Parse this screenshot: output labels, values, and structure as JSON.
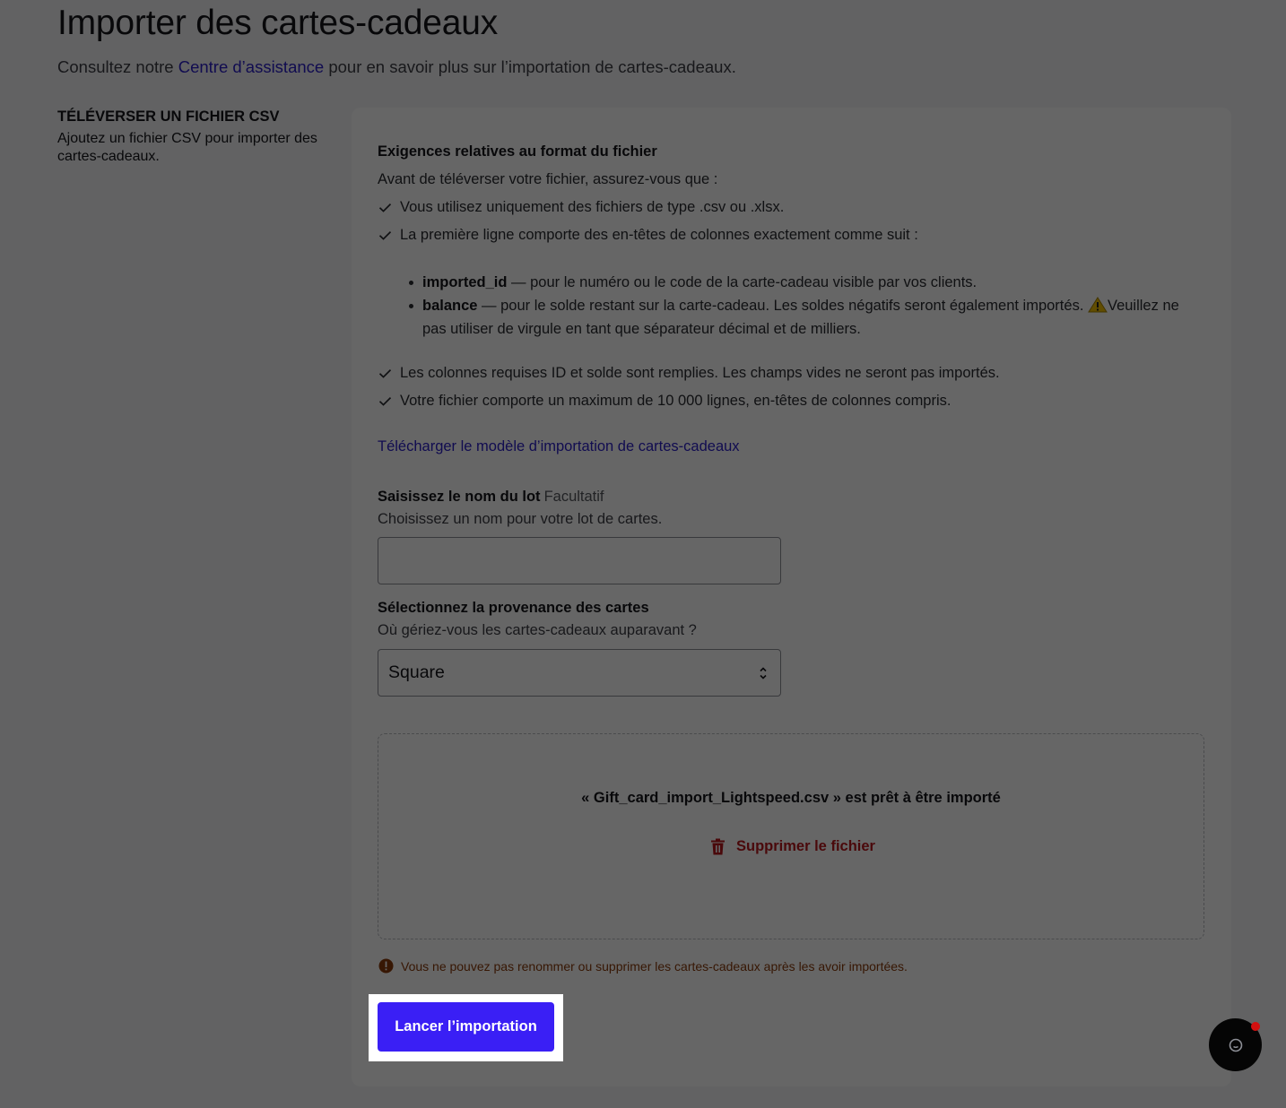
{
  "header": {
    "title": "Importer des cartes-cadeaux",
    "subtitle_before": "Consultez notre ",
    "subtitle_link": "Centre d’assistance",
    "subtitle_after": " pour en savoir plus sur l’importation de cartes-cadeaux."
  },
  "sidebar": {
    "title": "TÉLÉVERSER UN FICHIER CSV",
    "description": "Ajoutez un fichier CSV pour importer des cartes-cadeaux."
  },
  "requirements": {
    "title": "Exigences relatives au format du fichier",
    "intro": "Avant de téléverser votre fichier, assurez-vous que :",
    "checks": [
      "Vous utilisez uniquement des fichiers de type .csv ou .xlsx.",
      "La première ligne comporte des en-têtes de colonnes exactement comme suit :",
      "Les colonnes requises ID et solde sont remplies. Les champs vides ne seront pas importés.",
      "Votre fichier comporte un maximum de 10 000 lignes, en-têtes de colonnes compris."
    ],
    "columns": [
      {
        "name": "imported_id",
        "description": " — pour le numéro ou le code de la carte-cadeau visible par vos clients."
      },
      {
        "name": "balance",
        "description": " — pour le solde restant sur la carte-cadeau. Les soldes négatifs seront également importés. ",
        "warning": "Veuillez ne pas utiliser de virgule en tant que séparateur décimal et de milliers."
      }
    ],
    "template_link": "Télécharger le modèle d’importation de cartes-cadeaux"
  },
  "batch": {
    "label": "Saisissez le nom du lot",
    "optional": "Facultatif",
    "help": "Choisissez un nom pour votre lot de cartes.",
    "value": ""
  },
  "source": {
    "label": "Sélectionnez la provenance des cartes",
    "help": "Où gériez-vous les cartes-cadeaux auparavant ?",
    "selected": "Square"
  },
  "upload": {
    "ready_text": "« Gift_card_import_Lightspeed.csv » est prêt à être importé",
    "delete_label": "Supprimer le fichier"
  },
  "warning": {
    "text": "Vous ne pouvez pas renommer ou supprimer les cartes-cadeaux après les avoir importées."
  },
  "actions": {
    "start_import": "Lancer l’importation"
  },
  "colors": {
    "primary": "#3a1ff5",
    "link": "#2c20c9",
    "danger": "#b8171d",
    "warning": "#8a3a0a",
    "overlay": "rgba(0,0,0,0.6)"
  }
}
